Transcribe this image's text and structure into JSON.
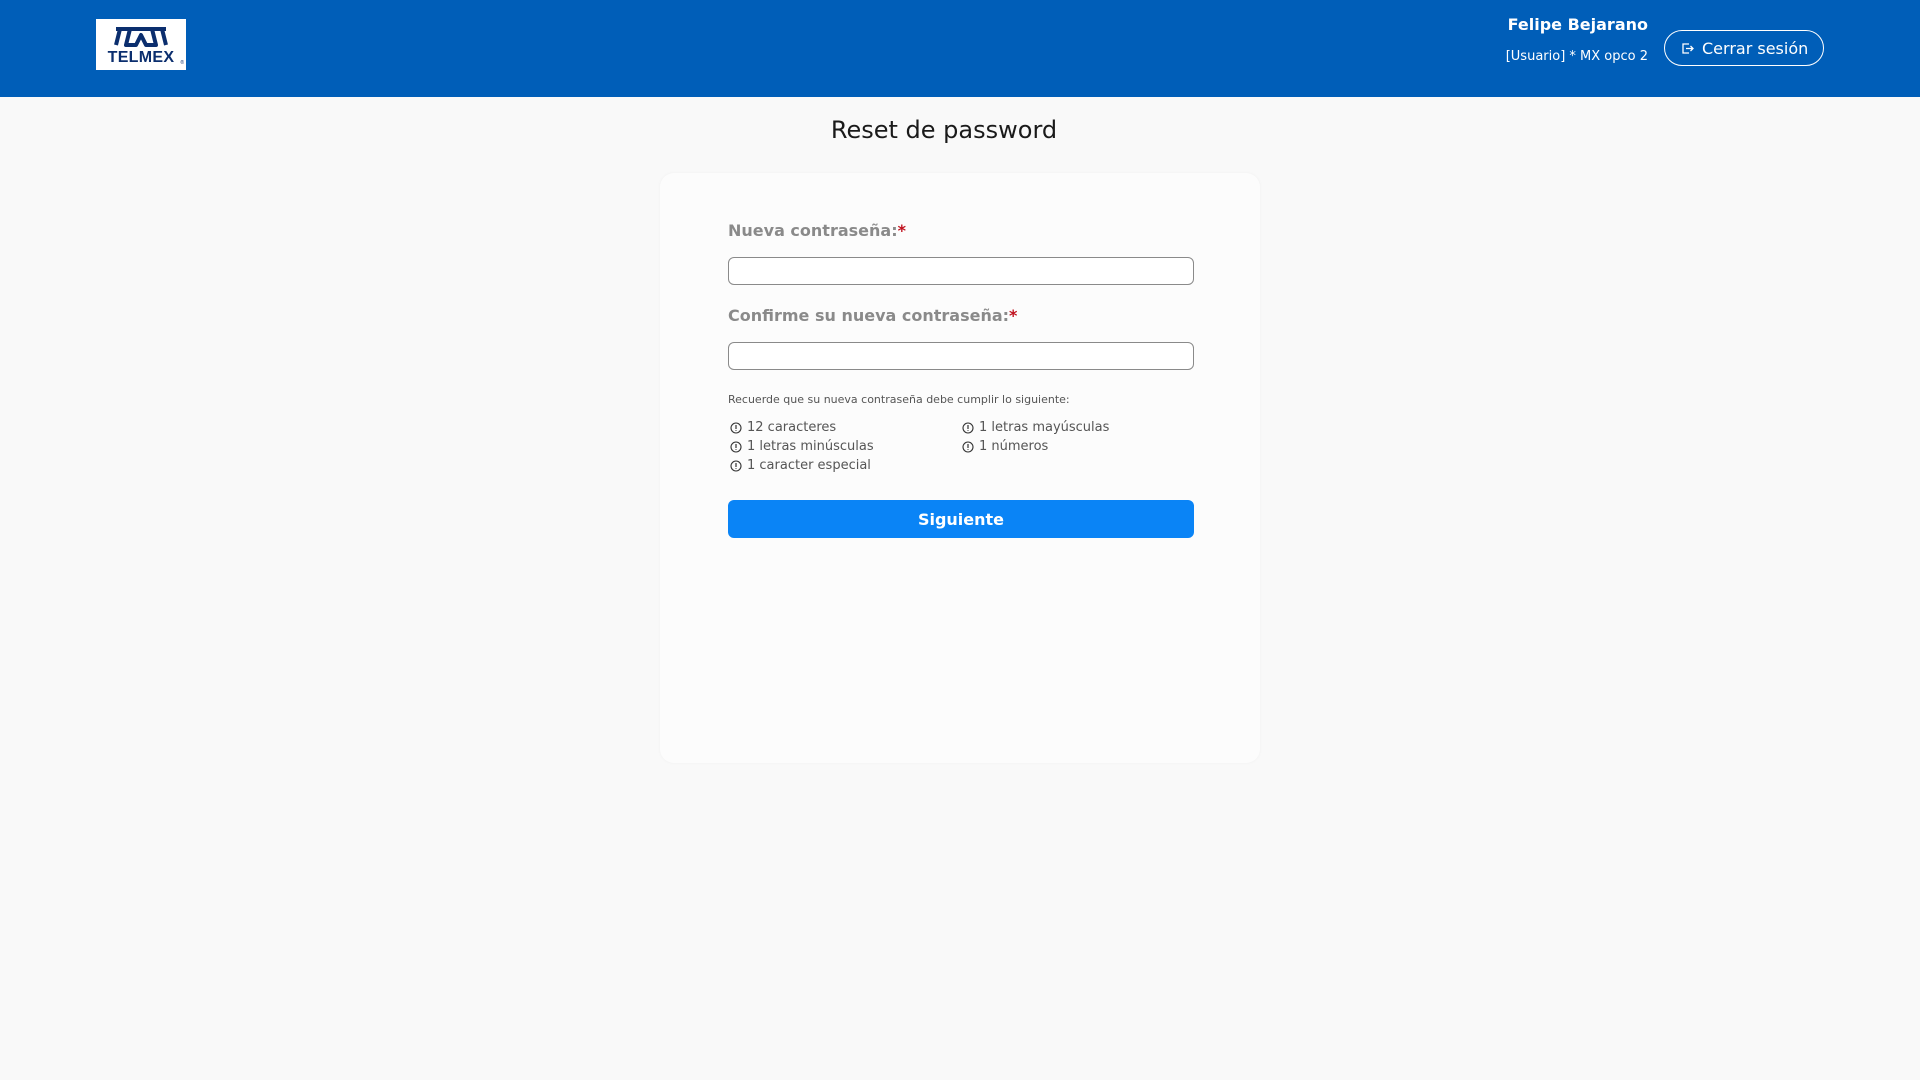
{
  "header": {
    "logo_text": "TELMEX",
    "logo_reg": "®",
    "user_name": "Felipe Bejarano",
    "user_role": "[Usuario] * MX opco 2",
    "logout_label": "Cerrar sesión"
  },
  "page": {
    "title": "Reset de password"
  },
  "form": {
    "new_password_label": "Nueva contraseña:",
    "new_password_value": "",
    "confirm_password_label": "Confirme su nueva contraseña:",
    "confirm_password_value": "",
    "required_mark": "*",
    "hint": "Recuerde que su nueva contraseña debe cumplir lo siguiente:",
    "rules": [
      "12 caracteres",
      "1 letras mayúsculas",
      "1 letras minúsculas",
      "1 números",
      "1 caracter especial"
    ],
    "submit_label": "Siguiente"
  },
  "colors": {
    "header_bg": "#005eb8",
    "primary_button": "#0a84f6",
    "required": "#c0101d"
  },
  "icons": {
    "rule_icon": "info-circle-icon",
    "logout_icon": "logout-icon"
  }
}
